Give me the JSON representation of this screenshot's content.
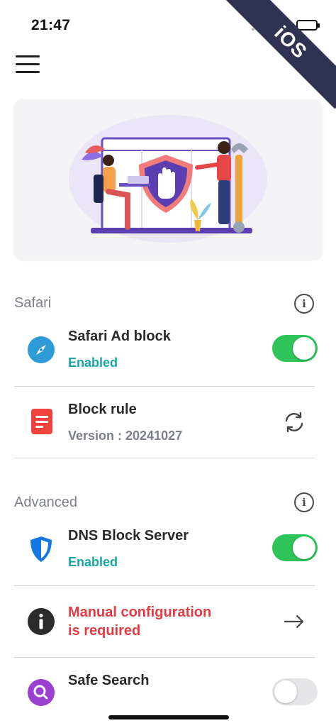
{
  "status_bar": {
    "time": "21:47",
    "icons": [
      "signal-dots-icon",
      "battery-charging-icon"
    ]
  },
  "platform_ribbon": {
    "label": "iOS",
    "color": "#2f3352"
  },
  "header": {
    "menu_icon": "hamburger-menu-icon"
  },
  "hero": {
    "illustration": "ad-block-shield-illustration"
  },
  "sections": {
    "safari": {
      "title": "Safari",
      "info_icon": "info-circle-icon",
      "items": {
        "ad_block": {
          "title": "Safari Ad block",
          "status": "Enabled",
          "icon": "compass-icon",
          "toggle_on": true
        },
        "block_rule": {
          "title": "Block rule",
          "version": "Version : 20241027",
          "icon": "document-icon",
          "action_icon": "refresh-icon"
        }
      }
    },
    "advanced": {
      "title": "Advanced",
      "info_icon": "info-circle-icon",
      "items": {
        "dns": {
          "title": "DNS Block Server",
          "status": "Enabled",
          "icon": "shield-icon",
          "toggle_on": true
        },
        "manual_config": {
          "title_line1": "Manual configuration",
          "title_line2": "is required",
          "icon": "info-filled-icon",
          "action_icon": "arrow-right-icon"
        },
        "safe_search": {
          "title": "Safe Search",
          "icon": "search-icon",
          "toggle_on": false
        }
      }
    }
  },
  "colors": {
    "accent_green": "#2fc45a",
    "status_teal": "#17a7a4",
    "warning_red": "#e23b42",
    "safari_blue": "#2e9bd6",
    "rule_red": "#f0433e",
    "shield_blue": "#1477e5",
    "search_purple": "#9b3fd1"
  }
}
